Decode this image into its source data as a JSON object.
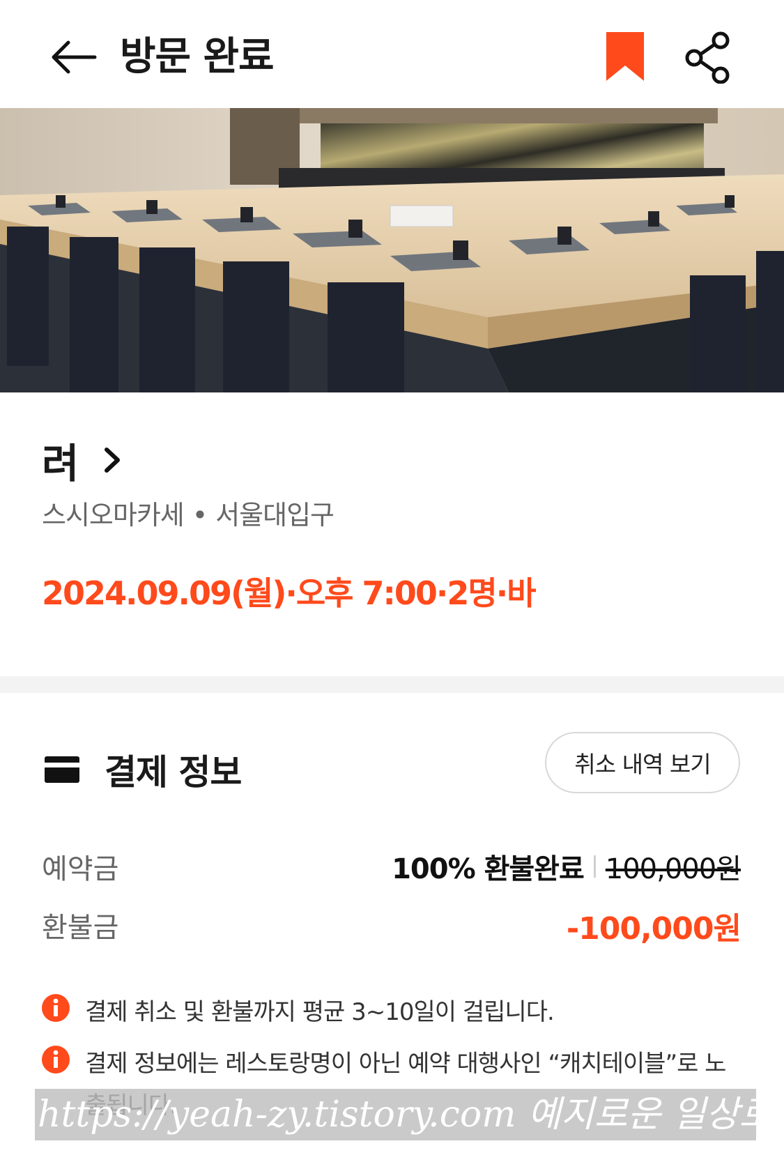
{
  "header": {
    "back_icon": "arrow-left-icon",
    "title": "방문 완료",
    "bookmark_icon": "bookmark-icon",
    "share_icon": "share-icon",
    "accent_color": "#ff4a1c"
  },
  "restaurant": {
    "name": "려",
    "category": "스시오마카세",
    "separator": "•",
    "location": "서울대입구",
    "reservation_text": "2024.09.09(월)·오후 7:00·2명·바"
  },
  "payment": {
    "icon": "card-icon",
    "title": "결제 정보",
    "cancel_history_button": "취소 내역 보기",
    "deposit_label": "예약금",
    "deposit_status": "100% 환불완료",
    "deposit_original": "100,000원",
    "refund_label": "환불금",
    "refund_amount": "-100,000원"
  },
  "notices": [
    {
      "icon": "info-icon",
      "text": "결제 취소 및 환불까지 평균 3~10일이 걸립니다."
    },
    {
      "icon": "info-icon",
      "text": "결제 정보에는 레스토랑명이 아닌 예약 대행사인 “캐치테이블”로 노출됩니다."
    }
  ],
  "watermark": "https://yeah-zy.tistory.com 예지로운 일상로그"
}
